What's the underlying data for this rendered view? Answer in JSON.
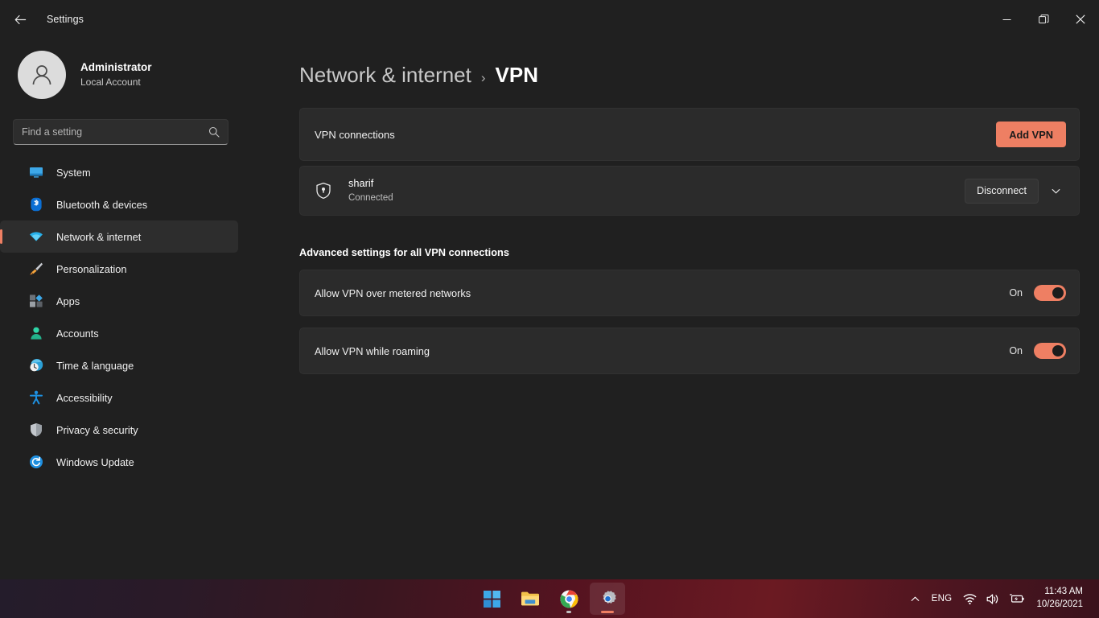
{
  "window": {
    "title": "Settings",
    "back_icon": "back-arrow-icon",
    "minimize_label": "–",
    "maximize_label": "restore-icon",
    "close_label": "✕"
  },
  "account": {
    "name": "Administrator",
    "subtitle": "Local Account",
    "avatar_icon": "person-avatar-icon"
  },
  "search": {
    "placeholder": "Find a setting",
    "value": "",
    "icon": "search-icon"
  },
  "sidebar": {
    "items": [
      {
        "label": "System",
        "icon": "display-icon",
        "selected": false
      },
      {
        "label": "Bluetooth & devices",
        "icon": "bluetooth-icon",
        "selected": false
      },
      {
        "label": "Network & internet",
        "icon": "wifi-icon",
        "selected": true
      },
      {
        "label": "Personalization",
        "icon": "paintbrush-icon",
        "selected": false
      },
      {
        "label": "Apps",
        "icon": "apps-icon",
        "selected": false
      },
      {
        "label": "Accounts",
        "icon": "account-person-icon",
        "selected": false
      },
      {
        "label": "Time & language",
        "icon": "clock-globe-icon",
        "selected": false
      },
      {
        "label": "Accessibility",
        "icon": "accessibility-icon",
        "selected": false
      },
      {
        "label": "Privacy & security",
        "icon": "shield-icon",
        "selected": false
      },
      {
        "label": "Windows Update",
        "icon": "update-refresh-icon",
        "selected": false
      }
    ]
  },
  "breadcrumb": {
    "parent": "Network & internet",
    "separator": "›",
    "current": "VPN"
  },
  "vpn_connections": {
    "label": "VPN connections",
    "add_button": "Add VPN",
    "connection": {
      "name": "sharif",
      "status": "Connected",
      "icon": "vpn-shield-lock-icon",
      "disconnect_button": "Disconnect",
      "expand_icon": "chevron-down-icon"
    }
  },
  "advanced": {
    "heading": "Advanced settings for all VPN connections",
    "settings": [
      {
        "label": "Allow VPN over metered networks",
        "state": "On",
        "on": true
      },
      {
        "label": "Allow VPN while roaming",
        "state": "On",
        "on": true
      }
    ]
  },
  "taskbar": {
    "apps": [
      {
        "name": "start-button",
        "icon": "windows-logo-icon",
        "active": false,
        "indicator": "none"
      },
      {
        "name": "file-explorer-button",
        "icon": "folder-icon",
        "active": false,
        "indicator": "none"
      },
      {
        "name": "chrome-button",
        "icon": "chrome-icon",
        "active": false,
        "indicator": "dot"
      },
      {
        "name": "settings-button",
        "icon": "gear-icon",
        "active": true,
        "indicator": "bar"
      }
    ],
    "tray": {
      "overflow_icon": "chevron-up-icon",
      "language": "ENG",
      "wifi_icon": "wifi-icon",
      "volume_icon": "speaker-icon",
      "battery_icon": "battery-charging-icon",
      "time": "11:43 AM",
      "date": "10/26/2021"
    }
  },
  "colors": {
    "accent": "#ee7f63",
    "page_bg": "#202020",
    "card_bg": "#2b2b2b"
  }
}
